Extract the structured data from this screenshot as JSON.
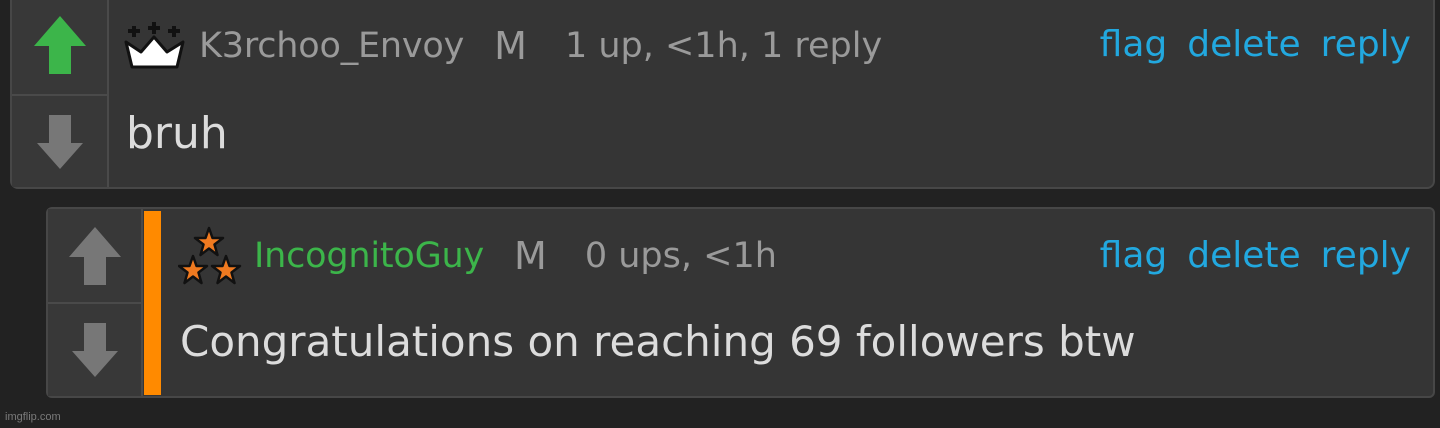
{
  "comments": [
    {
      "badge": "crown-icon",
      "username": "K3rchoo_Envoy",
      "username_color": "#9a9a9a",
      "mod_label": "M",
      "stats": "1 up, <1h, 1 reply",
      "actions": {
        "flag": "flag",
        "delete": "delete",
        "reply": "reply"
      },
      "body": "bruh",
      "upvoted": true
    },
    {
      "badge": "stars-icon",
      "username": "IncognitoGuy",
      "username_color": "#3cb54a",
      "mod_label": "M",
      "stats": "0 ups, <1h",
      "actions": {
        "flag": "flag",
        "delete": "delete",
        "reply": "reply"
      },
      "body": "Congratulations on reaching 69 followers btw",
      "upvoted": false
    }
  ],
  "colors": {
    "upvote_active": "#3cb54a",
    "vote_inactive": "#777777",
    "action_link": "#22a8df",
    "flair_bar": "#ff8a00"
  },
  "watermark": "imgflip.com"
}
